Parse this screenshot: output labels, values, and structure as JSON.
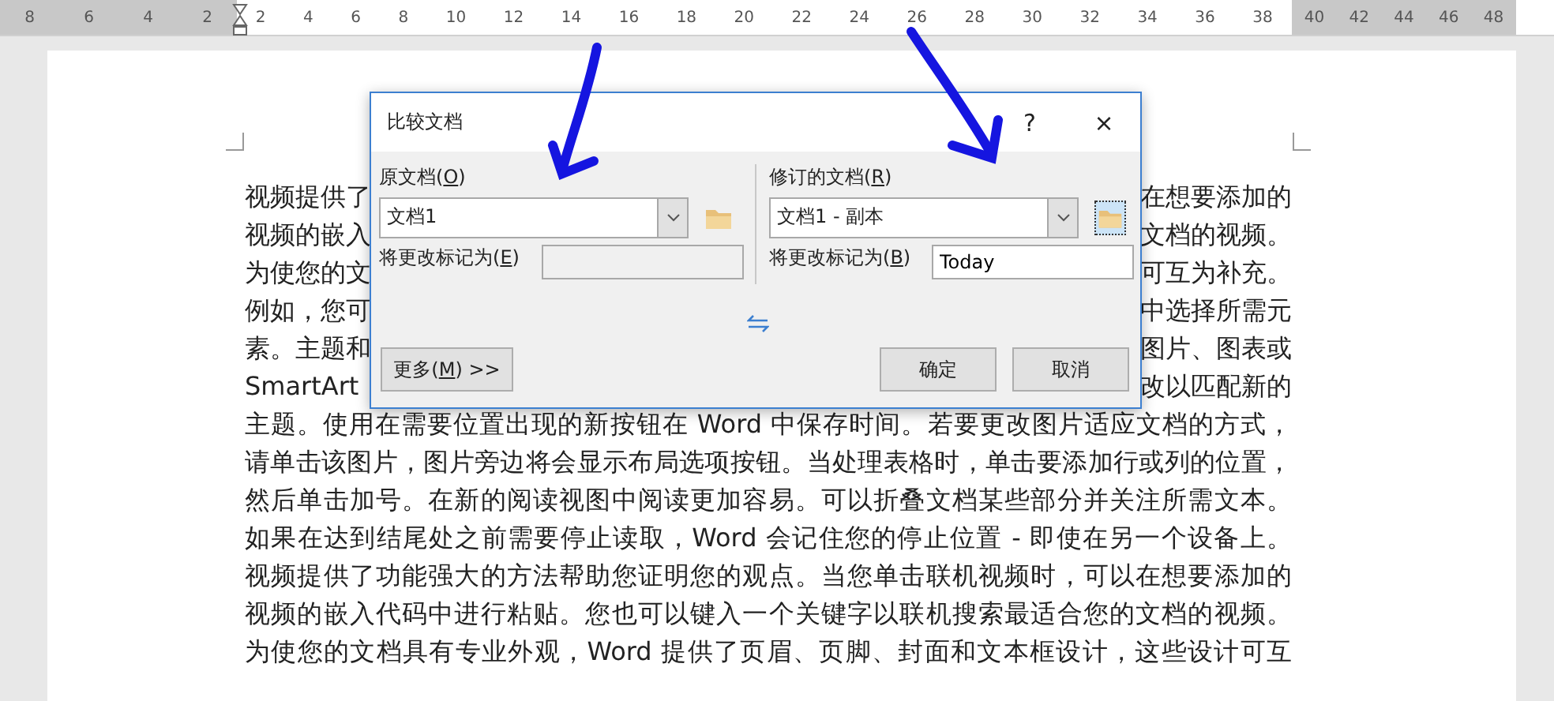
{
  "ruler": {
    "left_labels": [
      "8",
      "6",
      "4",
      "2"
    ],
    "labels": [
      "2",
      "4",
      "6",
      "8",
      "10",
      "12",
      "14",
      "16",
      "18",
      "20",
      "22",
      "24",
      "26",
      "28",
      "30",
      "32",
      "34",
      "36",
      "38"
    ],
    "right_labels": [
      "40",
      "42",
      "44",
      "46",
      "48"
    ]
  },
  "document": {
    "lines": [
      {
        "kind": "covered",
        "left": "视频提供了",
        "right": "在想要添加的"
      },
      {
        "kind": "covered",
        "left": "视频的嵌入",
        "right": "文档的视频。"
      },
      {
        "kind": "covered",
        "left": "为使您的文",
        "right": "可互为补充。"
      },
      {
        "kind": "covered",
        "left": "例如，您可",
        "right": "中选择所需元"
      },
      {
        "kind": "covered",
        "left": "素。主题和",
        "right": "图片、图表或"
      },
      {
        "kind": "covered",
        "left": "SmartArt",
        "right": "改以匹配新的"
      },
      {
        "kind": "full",
        "text": "主题。使用在需要位置出现的新按钮在 Word 中保存时间。若要更改图片适应文档的方式，"
      },
      {
        "kind": "full",
        "text": "请单击该图片，图片旁边将会显示布局选项按钮。当处理表格时，单击要添加行或列的位置，"
      },
      {
        "kind": "full",
        "text": "然后单击加号。在新的阅读视图中阅读更加容易。可以折叠文档某些部分并关注所需文本。"
      },
      {
        "kind": "full",
        "text": "如果在达到结尾处之前需要停止读取，Word 会记住您的停止位置 - 即使在另一个设备上。"
      },
      {
        "kind": "full",
        "text": "视频提供了功能强大的方法帮助您证明您的观点。当您单击联机视频时，可以在想要添加的"
      },
      {
        "kind": "full",
        "text": "视频的嵌入代码中进行粘贴。您也可以键入一个关键字以联机搜索最适合您的文档的视频。"
      },
      {
        "kind": "full",
        "text": "为使您的文档具有专业外观，Word 提供了页眉、页脚、封面和文本框设计，这些设计可互"
      }
    ]
  },
  "dialog": {
    "title": "比较文档",
    "help": "?",
    "close": "×",
    "original": {
      "label": "原文档(O)",
      "value": "文档1",
      "mark_label": "将更改标记为(E)",
      "mark_disabled": true
    },
    "revised": {
      "label": "修订的文档(R)",
      "value": "文档1 - 副本",
      "mark_label": "将更改标记为(B)",
      "mark_value": "Today",
      "mark_disabled": false
    },
    "more_button": "更多(M) >>",
    "ok_button": "确定",
    "cancel_button": "取消"
  }
}
